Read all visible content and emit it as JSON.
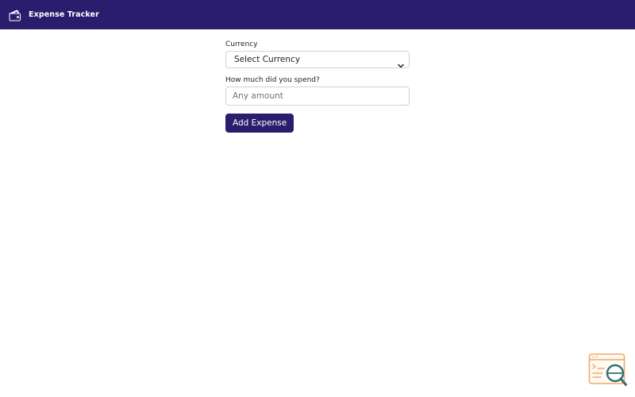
{
  "navbar": {
    "brand_icon": "wallet-icon",
    "brand_text": "Expense Tracker"
  },
  "form": {
    "currency_label": "Currency",
    "currency_selected": "Select Currency",
    "amount_label": "How much did you spend?",
    "amount_placeholder": "Any amount",
    "amount_value": "",
    "submit_label": "Add Expense"
  },
  "widget": {
    "icon": "code-search-icon"
  },
  "colors": {
    "navbar_bg": "#2a1d6e",
    "button_bg": "#2a1d6e",
    "widget_accent": "#f0a868",
    "widget_magnifier": "#2f6f73"
  }
}
